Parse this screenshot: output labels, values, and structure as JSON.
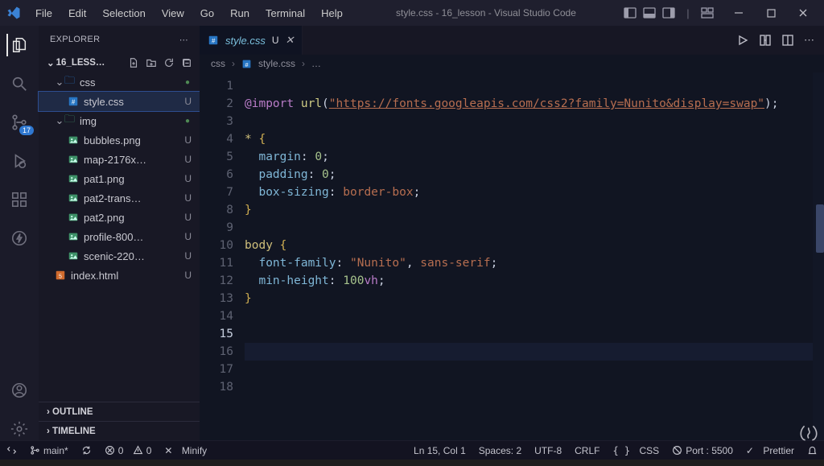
{
  "title": "style.css - 16_lesson - Visual Studio Code",
  "menus": [
    "File",
    "Edit",
    "Selection",
    "View",
    "Go",
    "Run",
    "Terminal",
    "Help"
  ],
  "activity_badge": "17",
  "sidebar": {
    "header": "EXPLORER",
    "folder": "16_LESS…",
    "tree": {
      "css_folder": "css",
      "style_file": "style.css",
      "style_status": "U",
      "img_folder": "img",
      "files": [
        {
          "label": "bubbles.png",
          "status": "U"
        },
        {
          "label": "map-2176x…",
          "status": "U"
        },
        {
          "label": "pat1.png",
          "status": "U"
        },
        {
          "label": "pat2-trans…",
          "status": "U"
        },
        {
          "label": "pat2.png",
          "status": "U"
        },
        {
          "label": "profile-800…",
          "status": "U"
        },
        {
          "label": "scenic-220…",
          "status": "U"
        }
      ],
      "index_file": "index.html",
      "index_status": "U"
    },
    "outline": "OUTLINE",
    "timeline": "TIMELINE"
  },
  "tab": {
    "name": "style.css",
    "status": "U"
  },
  "breadcrumb": {
    "p1": "css",
    "p2": "style.css",
    "p3": "…"
  },
  "code": {
    "lines": [
      "1",
      "2",
      "3",
      "4",
      "5",
      "6",
      "7",
      "8",
      "9",
      "10",
      "11",
      "12",
      "13",
      "14",
      "15",
      "16",
      "17",
      "18"
    ],
    "import_kw": "@import",
    "url_fn": "url",
    "url_str": "\"https://fonts.googleapis.com/css2?family=Nunito&display=swap\"",
    "star": "*",
    "margin": "margin",
    "zero": "0",
    "padding": "padding",
    "boxsizing": "box-sizing",
    "borderbox": "border-box",
    "body": "body",
    "fontfamily": "font-family",
    "nunito": "\"Nunito\"",
    "sans": "sans-serif",
    "minheight": "min-height",
    "hundred": "100",
    "vh": "vh"
  },
  "status": {
    "branch": "main*",
    "errors": "0",
    "warnings": "0",
    "minify": "Minify",
    "lncol": "Ln 15, Col 1",
    "spaces": "Spaces: 2",
    "encoding": "UTF-8",
    "eol": "CRLF",
    "lang": "CSS",
    "port": "Port : 5500",
    "prettier": "Prettier"
  }
}
